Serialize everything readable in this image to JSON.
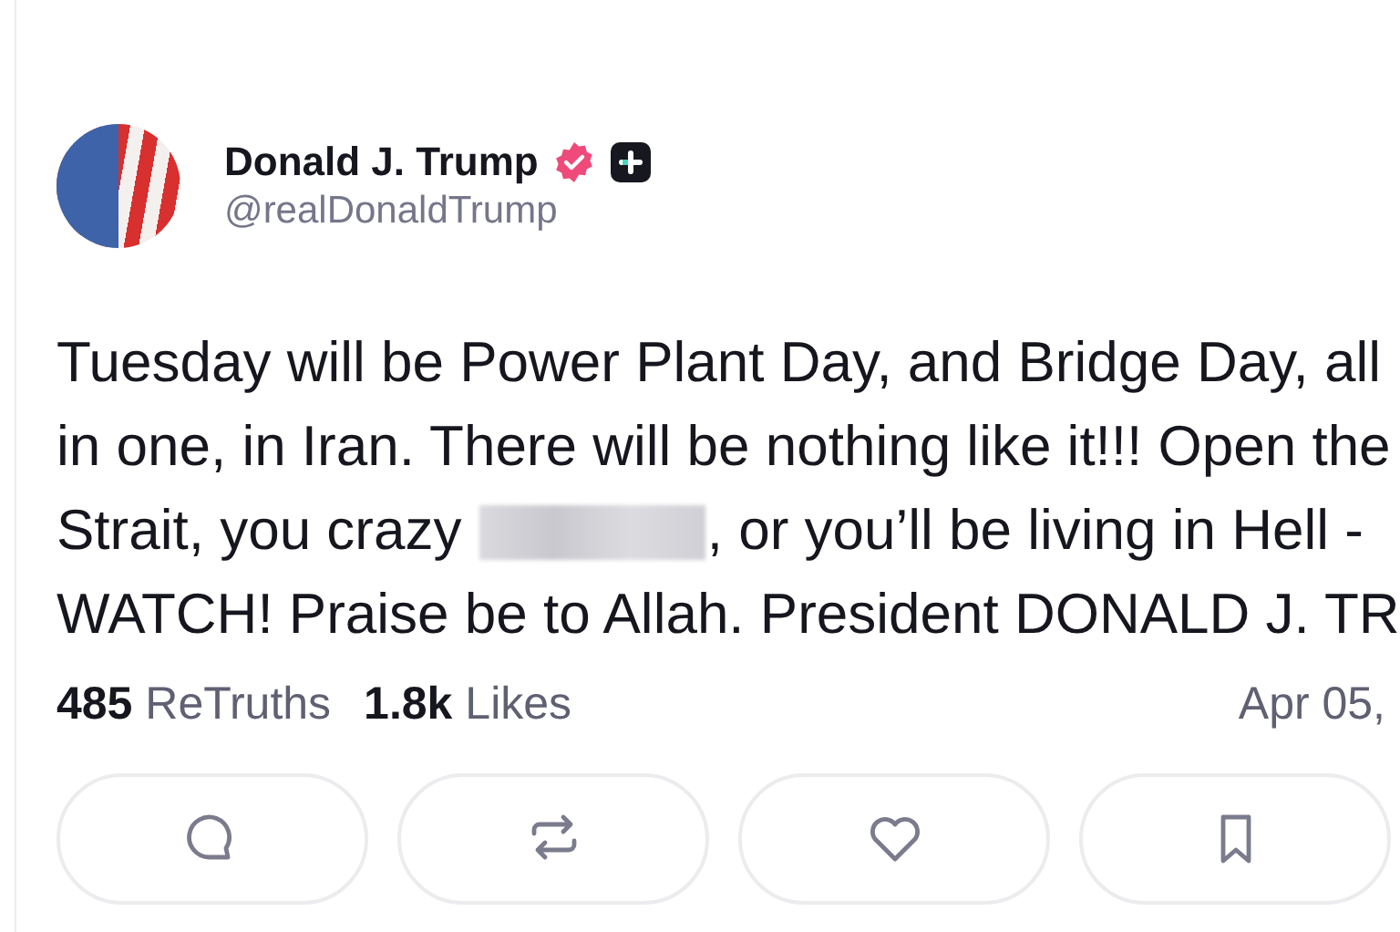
{
  "author": {
    "name": "Donald J. Trump",
    "handle": "@realDonaldTrump",
    "verified": true
  },
  "post_lines": [
    {
      "kind": "text",
      "text": "Tuesday will be Power Plant Day, and Bridge Day, all"
    },
    {
      "kind": "text",
      "text": "in one, in Iran. There will be nothing like it!!! Open the"
    },
    {
      "kind": "redacted",
      "before": "Strait, you crazy",
      "after": ", or you’ll be living in Hell -"
    },
    {
      "kind": "text",
      "text": "WATCH! Praise be to Allah. President DONALD J. TR"
    }
  ],
  "stats": [
    "**485** ReTruths",
    "**1.8k** Likes"
  ],
  "date": "Apr 05,",
  "actions": [
    {
      "kind": "reply"
    },
    {
      "kind": "retruth"
    },
    {
      "kind": "like"
    },
    {
      "kind": "bookmark"
    }
  ]
}
